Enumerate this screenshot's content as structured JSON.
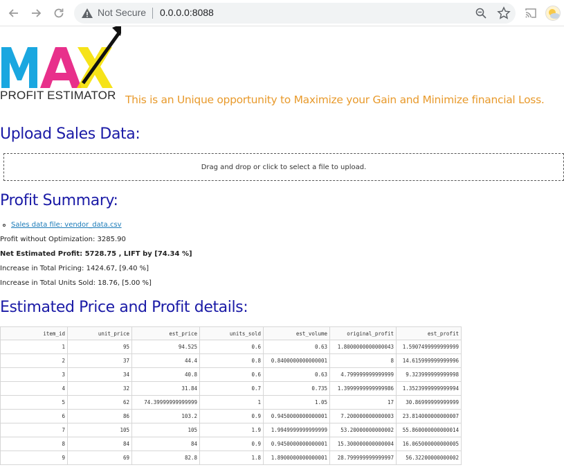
{
  "browser": {
    "security_label": "Not Secure",
    "url": "0.0.0.0:8088"
  },
  "header": {
    "logo_text": "MAX",
    "logo_subtitle": "PROFIT ESTIMATOR",
    "tagline": "This is an Unique opportunity to Maximize your Gain and Minimize financial Loss."
  },
  "upload": {
    "heading": "Upload Sales Data:",
    "dropzone_text": "Drag and drop or click to select a file to upload."
  },
  "summary": {
    "heading": "Profit Summary:",
    "file_link": "Sales data file: vendor_data.csv",
    "profit_without": "Profit without Optimization: 3285.90",
    "net_estimated": "Net Estimated Profit: 5728.75 , LIFT by [74.34 %]",
    "pricing_increase": "Increase in Total Pricing: 1424.67, [9.40 %]",
    "units_increase": "Increase in Total Units Sold: 18.76, [5.00 %]"
  },
  "details": {
    "heading": "Estimated Price and Profit details:",
    "columns": [
      "item_id",
      "unit_price",
      "est_price",
      "units_sold",
      "est_volume",
      "original_profit",
      "est_profit"
    ],
    "rows": [
      [
        "1",
        "95",
        "94.525",
        "0.6",
        "0.63",
        "1.8000000000000043",
        "1.5907499999999999"
      ],
      [
        "2",
        "37",
        "44.4",
        "0.8",
        "0.8400000000000001",
        "8",
        "14.615999999999996"
      ],
      [
        "3",
        "34",
        "40.8",
        "0.6",
        "0.63",
        "4.799999999999999",
        "9.323999999999998"
      ],
      [
        "4",
        "32",
        "31.84",
        "0.7",
        "0.735",
        "1.3999999999999986",
        "1.3523999999999994"
      ],
      [
        "5",
        "62",
        "74.39999999999999",
        "1",
        "1.05",
        "17",
        "30.86999999999999"
      ],
      [
        "6",
        "86",
        "103.2",
        "0.9",
        "0.9450000000000001",
        "7.200000000000003",
        "23.814000000000007"
      ],
      [
        "7",
        "105",
        "105",
        "1.9",
        "1.9949999999999999",
        "53.20000000000002",
        "55.860000000000014"
      ],
      [
        "8",
        "84",
        "84",
        "0.9",
        "0.9450000000000001",
        "15.300000000000004",
        "16.065000000000005"
      ],
      [
        "9",
        "69",
        "82.8",
        "1.8",
        "1.8900000000000001",
        "28.799999999999997",
        "56.32200000000002"
      ]
    ]
  },
  "colors": {
    "heading_blue": "#1a1aa6",
    "tagline_orange": "#e89a2c",
    "logo_cyan": "#1aa7e0",
    "logo_magenta": "#e6197e",
    "logo_yellow": "#f5e000"
  }
}
